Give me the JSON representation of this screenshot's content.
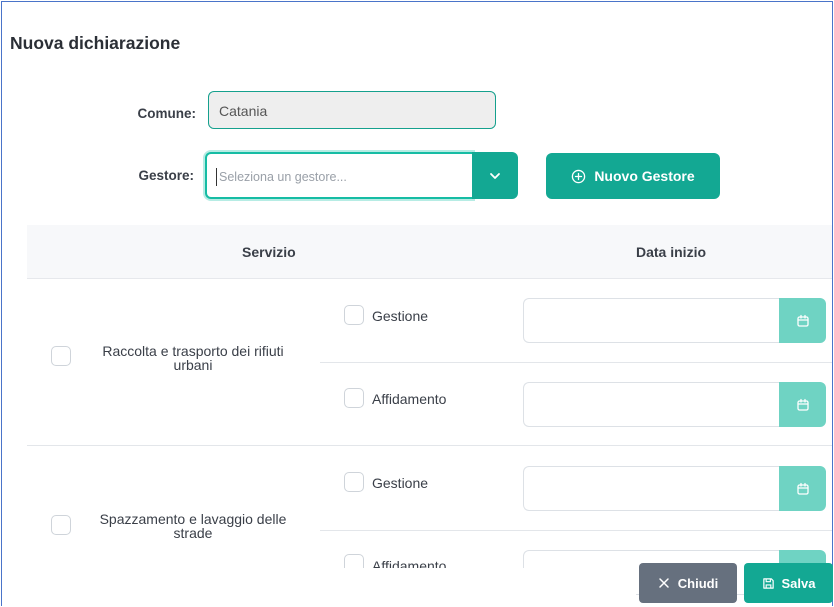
{
  "dialog": {
    "title": "Nuova dichiarazione"
  },
  "form": {
    "comune_label": "Comune:",
    "comune_value": "Catania",
    "gestore_label": "Gestore:",
    "gestore_placeholder": "Seleziona un gestore...",
    "nuovo_gestore_label": "Nuovo Gestore"
  },
  "table": {
    "headers": [
      "Servizio",
      "Data inizio"
    ],
    "services": [
      {
        "label_line1": "Raccolta e trasporto dei rifiuti",
        "label_line2": "urbani",
        "options": [
          "Gestione",
          "Affidamento"
        ]
      },
      {
        "label_line1": "Spazzamento e lavaggio delle",
        "label_line2": "strade",
        "options": [
          "Gestione",
          "Affidamento"
        ]
      }
    ]
  },
  "footer": {
    "close_label": "Chiudi",
    "save_label": "Salva"
  },
  "icons": {
    "nuovo": "plus-circle-icon",
    "dropdown": "chevron-down-icon",
    "date": "calendar-icon",
    "close": "close-icon",
    "save": "save-icon"
  },
  "colors": {
    "primary": "#13a893",
    "primary_light": "#6fd3c3",
    "secondary": "#66707e",
    "border_accent": "#4a74c9"
  }
}
